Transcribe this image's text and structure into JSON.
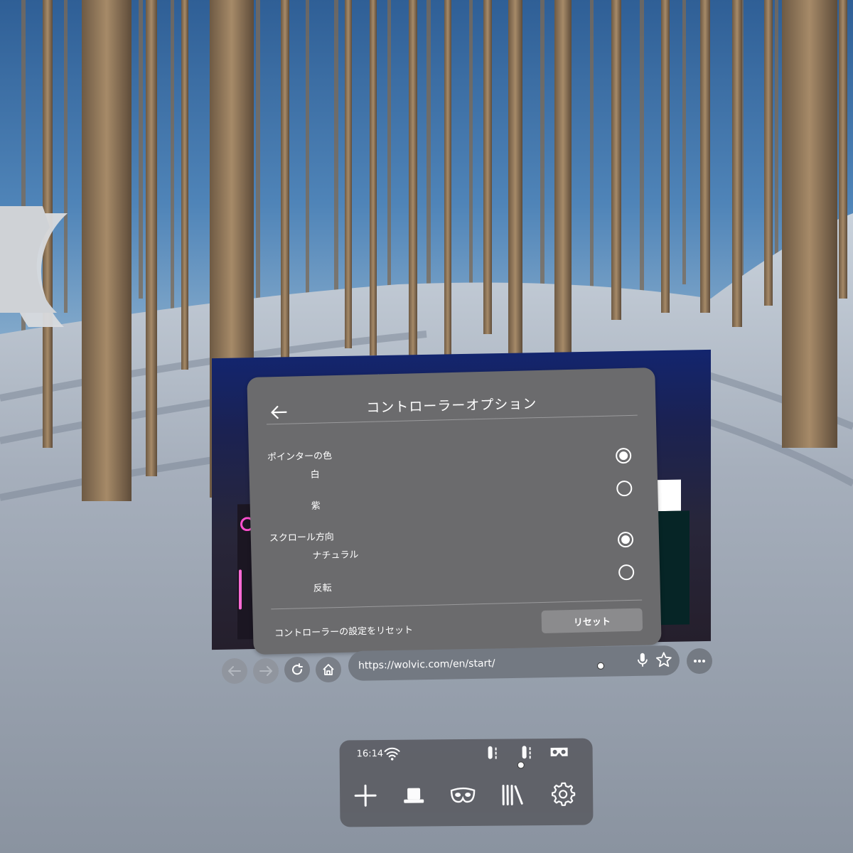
{
  "dialog": {
    "title": "コントローラーオプション",
    "pointer_color": {
      "label": "ポインターの色",
      "options": [
        {
          "label": "白",
          "checked": true
        },
        {
          "label": "紫",
          "checked": false
        }
      ]
    },
    "scroll_direction": {
      "label": "スクロール方向",
      "options": [
        {
          "label": "ナチュラル",
          "checked": true
        },
        {
          "label": "反転",
          "checked": false
        }
      ]
    },
    "reset": {
      "description": "コントローラーの設定をリセット",
      "button_label": "リセット"
    }
  },
  "browser": {
    "url": "https://wolvic.com/en/start/"
  },
  "tray": {
    "time": "16:14",
    "items": [
      {
        "icon": "add-icon"
      },
      {
        "icon": "hat-icon"
      },
      {
        "icon": "privacy-mask-icon"
      },
      {
        "icon": "library-icon"
      },
      {
        "icon": "settings-gear-icon"
      }
    ]
  },
  "colors": {
    "dialog_bg": "#6b6b6d",
    "reset_button": "#8b8b8d",
    "tray_bg": "#5f6168"
  }
}
